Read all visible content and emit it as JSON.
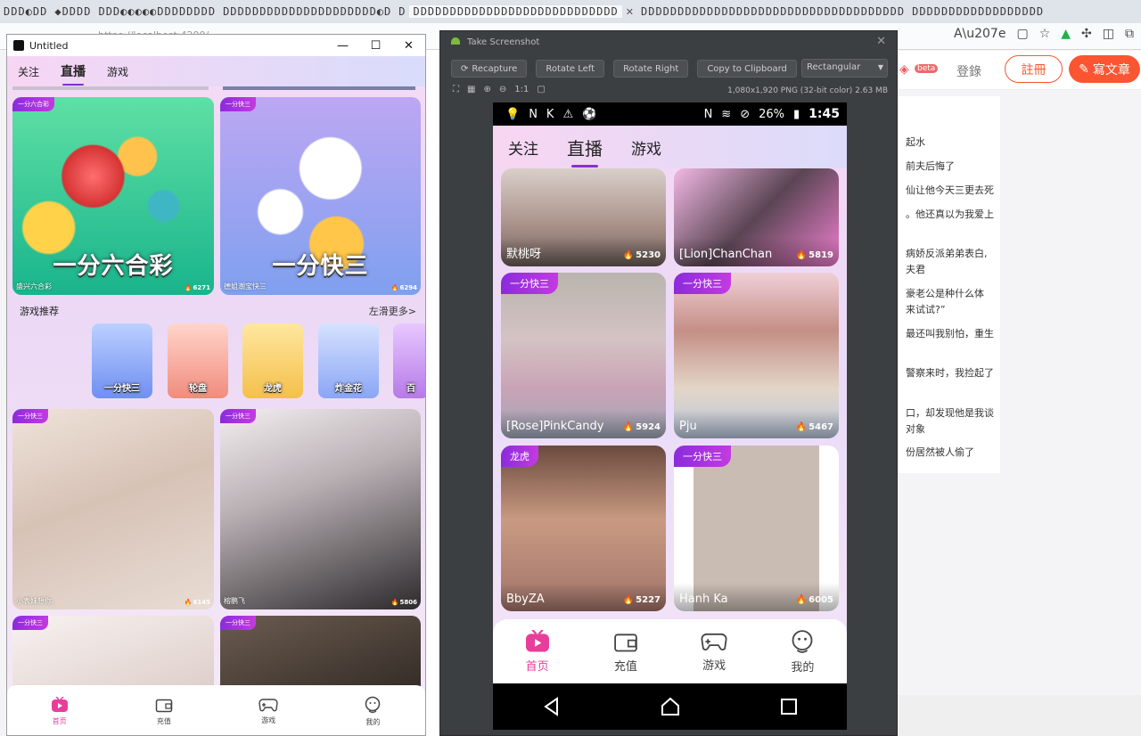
{
  "browser": {
    "tab_strip_segments": [
      "DDD◐DD",
      "◆DDDD",
      "DDD◐◐◐◐◐DDDDDDDD",
      "DDDDDDDDDDDDDDDDDDDDD◐D",
      "D",
      "DDDDDDDDDDDDDDDDDDDDDDDDDDDD",
      "DDDDDDDDDDDDDDDDDDDDDDDDDDDDDDDDDDDD",
      "DDDDDDDDDDDDDDDDDD"
    ],
    "tab_close": "✕",
    "address": "https://localhost:4200/...",
    "site": {
      "beta": "beta",
      "login": "登錄",
      "register": "註冊",
      "write": "寫文章"
    },
    "article_lines": [
      "起水",
      "前夫后悔了",
      "仙让他今天三更去死",
      "。他还真以为我爱上",
      "病娇反派弟弟表白,",
      "夫君",
      "豪老公是种什么体",
      "来试试?”",
      "最还叫我别怕，重生",
      "警察来时，我捡起了",
      "口，却发现他是我谈",
      "对象",
      "份居然被人偷了"
    ]
  },
  "left_window": {
    "title": "Untitled",
    "controls": [
      "—",
      "☐",
      "✕"
    ],
    "tabs": [
      "关注",
      "直播",
      "游戏"
    ],
    "active_tab": 1,
    "featured": [
      {
        "badge": "一分六合彩",
        "big_title": "一分六合彩",
        "name": "盛兴六合彩",
        "heat": "6271"
      },
      {
        "badge": "一分快三",
        "big_title": "一分快三",
        "name": "德姐潮宝快三",
        "heat": "6294"
      }
    ],
    "section_title": "游戏推荐",
    "section_more": "左滑更多>",
    "games": [
      "一分快三",
      "轮盘",
      "龙虎",
      "炸金花",
      "百"
    ],
    "streams": [
      {
        "badge": "一分快三",
        "name": "小表妹想你.",
        "heat": "6145"
      },
      {
        "badge": "一分快三",
        "name": "榕鹏飞",
        "heat": "5806"
      },
      {
        "badge": "一分快三",
        "name": "",
        "heat": ""
      },
      {
        "badge": "一分快三",
        "name": "",
        "heat": ""
      }
    ],
    "bottom_nav": [
      "首页",
      "充值",
      "游戏",
      "我的"
    ]
  },
  "screenshot_window": {
    "title": "Take Screenshot",
    "close": "✕",
    "buttons": [
      "Recapture",
      "Rotate Left",
      "Rotate Right",
      "Copy to Clipboard"
    ],
    "frame_select": "Rectangular",
    "icon_row": [
      "⛶",
      "▦",
      "⊕",
      "⊖",
      "1:1",
      "▢"
    ],
    "info": "1,080x1,920 PNG (32-bit color) 2.63 MB",
    "status": {
      "battery": "26%",
      "time": "1:45"
    },
    "tabs": [
      "关注",
      "直播",
      "游戏"
    ],
    "active_tab": 1,
    "streams": [
      {
        "badge": "",
        "name": "默桃呀",
        "heat": "5230"
      },
      {
        "badge": "",
        "name": "[Lion]ChanChan",
        "heat": "5819"
      },
      {
        "badge": "一分快三",
        "name": "[Rose]PinkCandy",
        "heat": "5924"
      },
      {
        "badge": "一分快三",
        "name": "Pju",
        "heat": "5467"
      },
      {
        "badge": "龙虎",
        "name": "BbyZA",
        "heat": "5227"
      },
      {
        "badge": "一分快三",
        "name": "Hanh Ka",
        "heat": "6005"
      }
    ],
    "bottom_nav": [
      "首页",
      "充值",
      "游戏",
      "我的"
    ]
  },
  "colors": {
    "accent_purple": "#8a2fd6",
    "active_pink": "#e83e9b",
    "brand_orange": "#fc5531"
  }
}
